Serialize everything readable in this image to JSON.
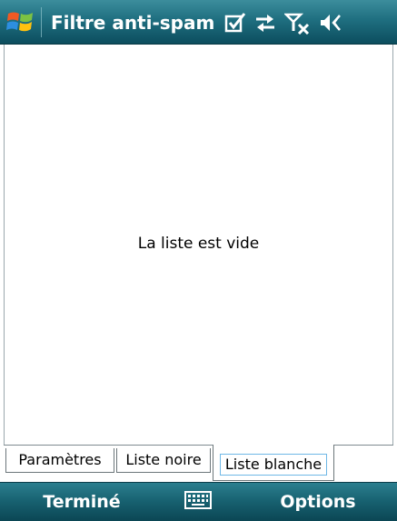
{
  "window": {
    "title": "Filtre anti-spam",
    "status_icons": [
      "checkbox-icon",
      "sync-icon",
      "signal-off-icon",
      "speaker-icon"
    ]
  },
  "content": {
    "empty_message": "La liste est vide"
  },
  "tabs": [
    {
      "label": "Paramètres",
      "active": false
    },
    {
      "label": "Liste noire",
      "active": false
    },
    {
      "label": "Liste blanche",
      "active": true
    }
  ],
  "softkeys": {
    "left": "Terminé",
    "right": "Options",
    "center_icon": "keyboard-icon"
  }
}
